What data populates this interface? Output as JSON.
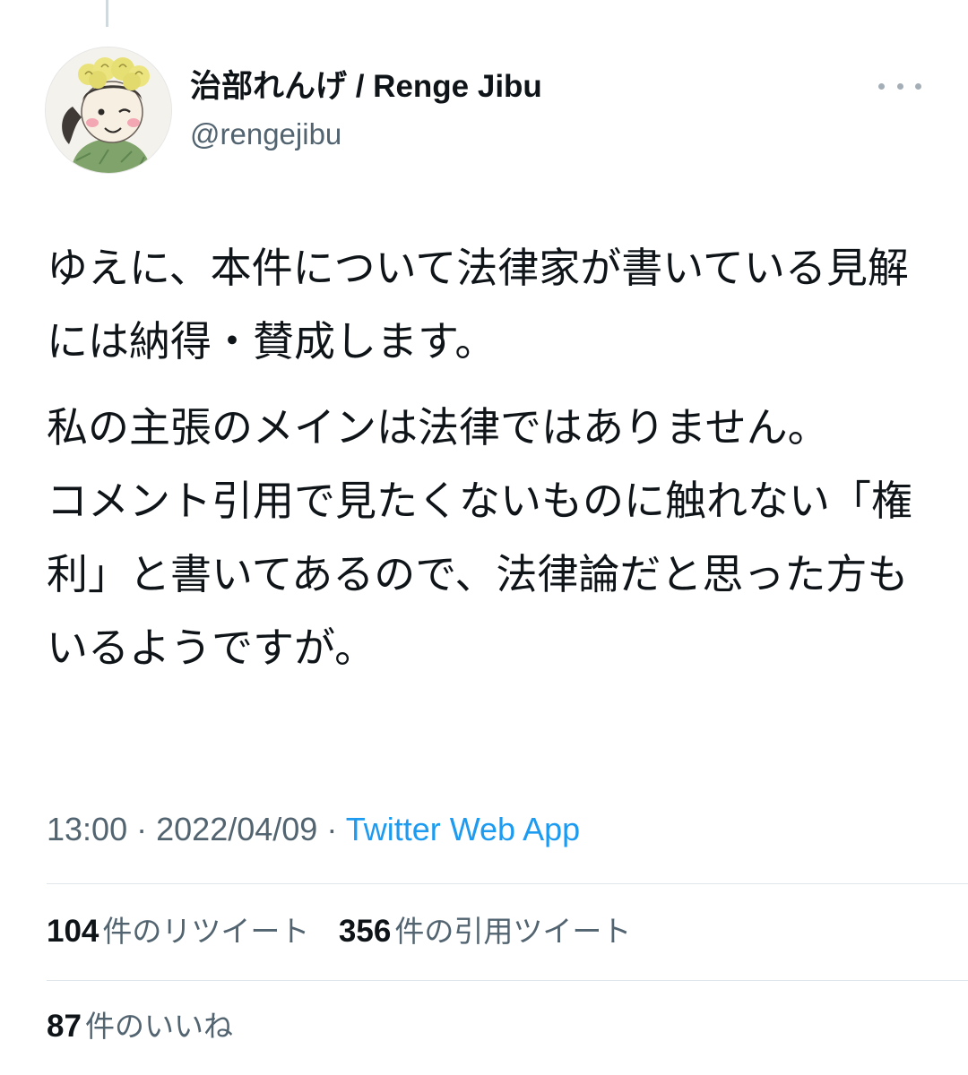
{
  "tweet": {
    "author": {
      "display_name": "治部れんげ / Renge Jibu",
      "handle": "@rengejibu"
    },
    "paragraphs": [
      "ゆえに、本件について法律家が書いている見解には納得・賛成します。",
      "私の主張のメインは法律ではありません。\nコメント引用で見たくないものに触れない「権利」と書いてあるので、法律論だと思った方もいるようですが。"
    ],
    "time": "13:00",
    "separator": "·",
    "date": "2022/04/09",
    "source": "Twitter Web App",
    "stats": {
      "retweets": {
        "count": "104",
        "label": "件のリツイート"
      },
      "quotes": {
        "count": "356",
        "label": "件の引用ツイート"
      },
      "likes": {
        "count": "87",
        "label": "件のいいね"
      }
    }
  },
  "icons": {
    "more": "more-horizontal-icon",
    "avatar": "profile-avatar"
  },
  "colors": {
    "text_primary": "#0f1419",
    "text_secondary": "#536471",
    "link": "#1d9bf0",
    "divider": "#e1e6ea"
  }
}
